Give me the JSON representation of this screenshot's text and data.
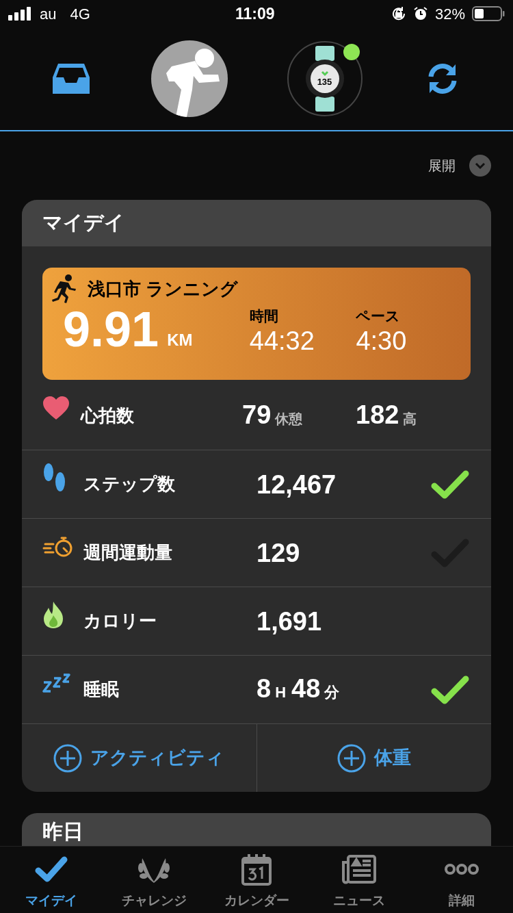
{
  "status_bar": {
    "carrier": "au",
    "network": "4G",
    "time": "11:09",
    "battery": "32%"
  },
  "header": {
    "watch_connected": true,
    "watch_reading": "135"
  },
  "expand": {
    "label": "展開"
  },
  "my_day": {
    "title": "マイデイ",
    "activity": {
      "title": "浅口市 ランニング",
      "distance": "9.91",
      "distance_unit": "KM",
      "stats": [
        {
          "label": "時間",
          "value": "44:32"
        },
        {
          "label": "ペース",
          "value": "4:30"
        }
      ]
    },
    "rows": [
      {
        "kind": "heart",
        "label": "心拍数",
        "values": [
          {
            "number": "79",
            "unit": "休憩"
          },
          {
            "number": "182",
            "unit": "高"
          }
        ]
      },
      {
        "kind": "steps",
        "label": "ステップ数",
        "values": [
          {
            "number": "12,467"
          }
        ],
        "goal_met": true
      },
      {
        "kind": "intensity",
        "label": "週間運動量",
        "values": [
          {
            "number": "129"
          }
        ],
        "goal_met": false
      },
      {
        "kind": "calories",
        "label": "カロリー",
        "values": [
          {
            "number": "1,691"
          }
        ]
      },
      {
        "kind": "sleep",
        "label": "睡眠",
        "values": [
          {
            "number": "8",
            "unit": "H"
          },
          {
            "number": "48",
            "unit": "分"
          }
        ],
        "goal_met": true
      }
    ],
    "add_buttons": [
      "アクティビティ",
      "体重"
    ]
  },
  "next_card": {
    "title": "昨日"
  },
  "tab_bar": [
    {
      "label": "マイデイ",
      "kind": "check",
      "selected": true
    },
    {
      "label": "チャレンジ",
      "kind": "laurel",
      "selected": false
    },
    {
      "label": "カレンダー",
      "kind": "calendar",
      "selected": false
    },
    {
      "label": "ニュース",
      "kind": "news",
      "selected": false
    },
    {
      "label": "詳細",
      "kind": "more",
      "selected": false
    }
  ]
}
